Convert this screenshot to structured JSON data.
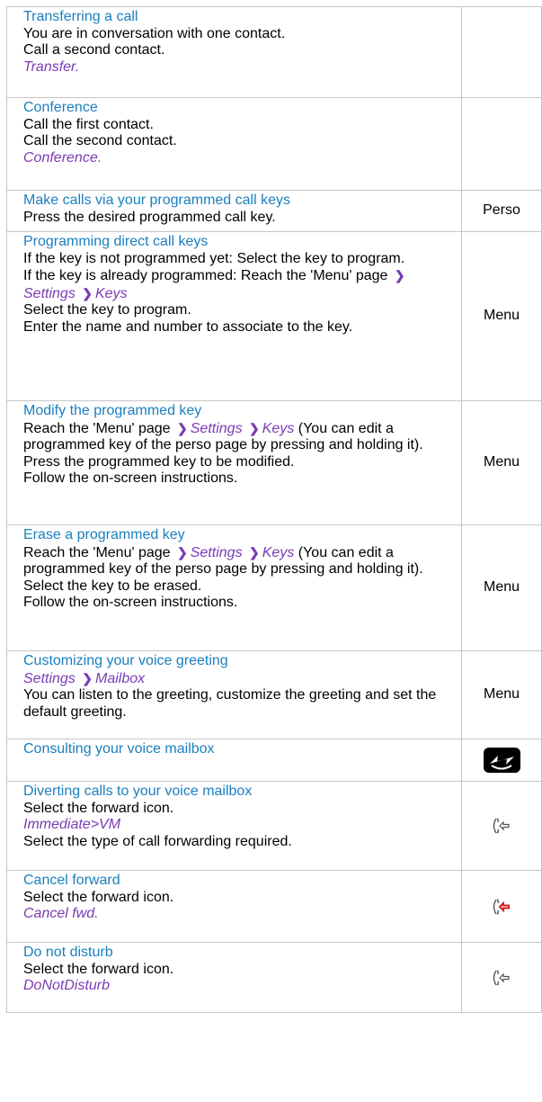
{
  "rows": {
    "transfer": {
      "title": "Transferring a call",
      "l1": "You are in conversation with one contact.",
      "l2": "Call a second contact.",
      "l3": "Transfer."
    },
    "conference": {
      "title": "Conference",
      "l1": "Call the first contact.",
      "l2": "Call the second contact.",
      "l3": "Conference."
    },
    "make_calls": {
      "title": "Make calls via your programmed call keys",
      "l1": "Press the desired programmed call key.",
      "side": "Perso"
    },
    "programming": {
      "title": "Programming direct call keys",
      "l1": "If the key is not programmed yet: Select the key to program.",
      "l2a": "If the key is already programmed: Reach the 'Menu' page",
      "settings": "Settings",
      "keys": "Keys",
      "l3": "Select the key to program.",
      "l4": "Enter the name and number to associate to the key.",
      "side": "Menu"
    },
    "modify": {
      "title": "Modify the programmed key",
      "l1a": "Reach the 'Menu' page",
      "settings": "Settings",
      "keys": "Keys",
      "l1b": " (You can edit a programmed key of the perso page by pressing and holding it).",
      "l2": "Press the programmed key to be modified.",
      "l3": "Follow the on-screen instructions.",
      "side": "Menu"
    },
    "erase": {
      "title": "Erase a programmed key",
      "l1a": "Reach the 'Menu' page",
      "settings": "Settings",
      "keys": "Keys",
      "l1b": " (You can edit a programmed key of the perso page by pressing and holding it).",
      "l2": "Select the key to be erased.",
      "l3": "Follow the on-screen instructions.",
      "side": "Menu"
    },
    "greeting": {
      "title": "Customizing your voice greeting",
      "settings": "Settings",
      "mailbox": "Mailbox",
      "l2": "You can listen to the greeting, customize the greeting and set the default greeting.",
      "side": "Menu"
    },
    "consult": {
      "title": "Consulting your voice mailbox",
      "icon": "voicemail-key-icon"
    },
    "divert": {
      "title": "Diverting calls to your voice mailbox",
      "l1": "Select the forward icon.",
      "l2": "Immediate>VM",
      "l3": "Select the type of call forwarding required.",
      "icon": "forward-icon"
    },
    "cancel": {
      "title": "Cancel forward",
      "l1": "Select the forward icon.",
      "l2": "Cancel fwd.",
      "icon": "forward-active-icon",
      "icon_color": "#d81e1e"
    },
    "dnd": {
      "title": "Do not disturb",
      "l1": "Select the forward icon.",
      "l2": "DoNotDisturb",
      "icon": "forward-icon"
    }
  },
  "colors": {
    "title": "#1a7fbf",
    "italic": "#7a3bb4",
    "border": "#c6c6c6"
  }
}
